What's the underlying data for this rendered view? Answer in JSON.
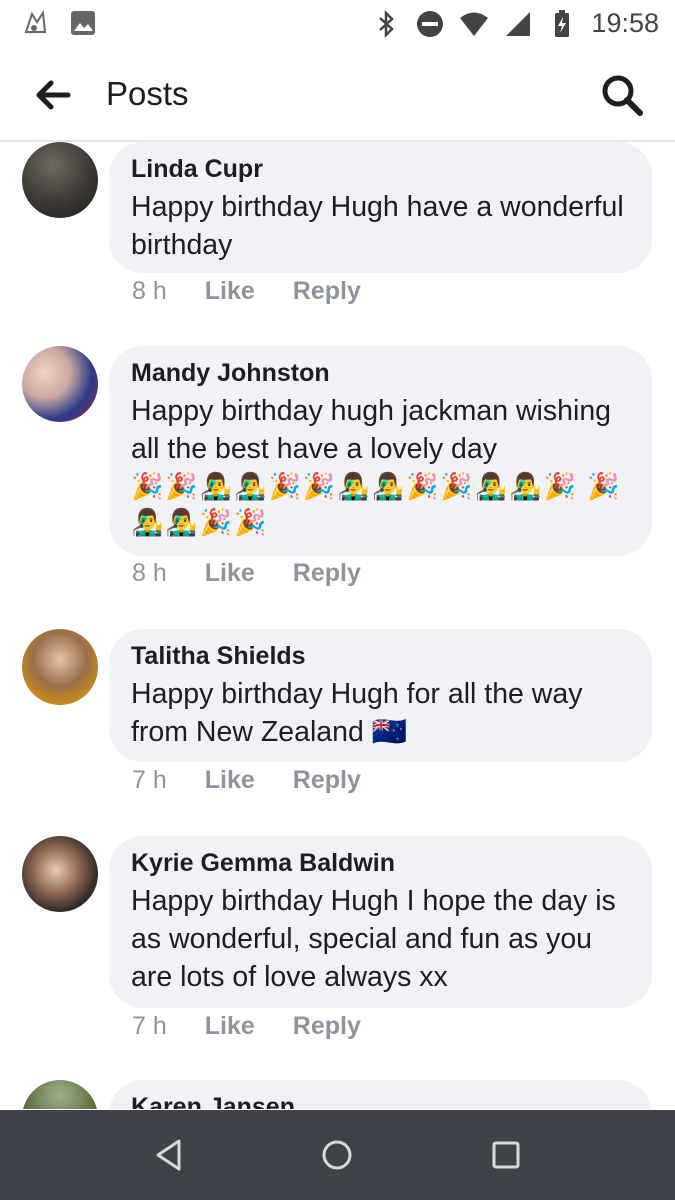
{
  "status_bar": {
    "time": "19:58",
    "icons": [
      "app-icon",
      "image-icon",
      "bluetooth-icon",
      "do-not-disturb-icon",
      "wifi-icon",
      "signal-icon",
      "battery-icon"
    ]
  },
  "header": {
    "title": "Posts",
    "back_icon": "back-arrow-icon",
    "search_icon": "search-icon"
  },
  "comments": [
    {
      "author": "Linda Cupr",
      "text": "Happy birthday Hugh have a wonderful birthday",
      "emojis": "",
      "time": "8 h",
      "like_label": "Like",
      "reply_label": "Reply"
    },
    {
      "author": "Mandy Johnston",
      "text": "Happy birthday hugh jackman wishing all the best have a lovely day",
      "emojis": "🎉🎉👨‍🎤👨‍🎤🎉🎉👨‍🎤👨‍🎤🎉🎉👨‍🎤👨‍🎤🎉 🎉👨‍🎤👨‍🎤🎉🎉",
      "time": "8 h",
      "like_label": "Like",
      "reply_label": "Reply"
    },
    {
      "author": "Talitha Shields",
      "text": "Happy birthday Hugh for all the way from New Zealand",
      "emojis": "🇳🇿",
      "time": "7 h",
      "like_label": "Like",
      "reply_label": "Reply"
    },
    {
      "author": "Kyrie Gemma Baldwin",
      "text": "Happy birthday Hugh I hope the day is as wonderful, special and fun as you are lots of love always xx",
      "emojis": "",
      "time": "7 h",
      "like_label": "Like",
      "reply_label": "Reply"
    },
    {
      "author": "Karen Jansen",
      "text": "",
      "emojis": "",
      "time": "",
      "like_label": "",
      "reply_label": ""
    }
  ],
  "nav_bar": {
    "icons": [
      "back-triangle-icon",
      "home-circle-icon",
      "recents-square-icon"
    ]
  },
  "colors": {
    "bubble": "#f0f2f5",
    "meta_text": "#8d949e",
    "nav_bg": "#3f4349"
  }
}
